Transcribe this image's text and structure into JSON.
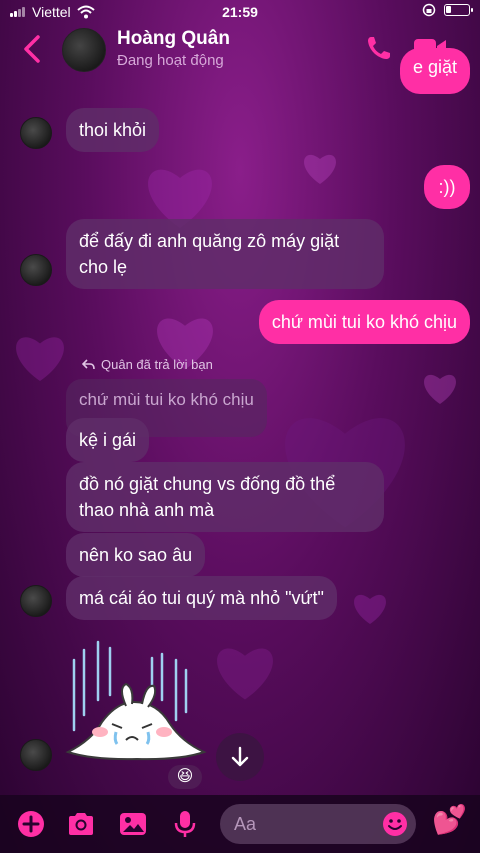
{
  "status_bar": {
    "carrier": "Viettel",
    "time": "21:59",
    "battery_level": 0.25
  },
  "header": {
    "name": "Hoàng Quân",
    "status": "Đang hoạt động",
    "back_icon": "chevron-left-icon",
    "call_icon": "phone-icon",
    "video_icon": "video-camera-icon"
  },
  "messages": {
    "m0": "e giặt",
    "m1": "thoi khỏi",
    "m2": ":))",
    "m3": "để đấy đi anh quăng zô máy giặt cho lẹ",
    "m4": "chứ mùi tui ko khó chịu",
    "reply_note": "Quân đã trả lời bạn",
    "quoted": "chứ mùi tui ko khó chịu",
    "m5": "kệ i gái",
    "m6": "đồ nó giặt chung vs đống đồ thể thao nhà anh mà",
    "m7": "nên ko sao âu",
    "m8": "má cái áo tui quý mà nhỏ \"vứt\"",
    "reaction": "😆"
  },
  "composer": {
    "placeholder": "Aa",
    "plus_icon": "plus-icon",
    "camera_icon": "camera-icon",
    "gallery_icon": "gallery-icon",
    "mic_icon": "microphone-icon",
    "emoji_icon": "emoji-icon",
    "like_icon": "hearts-icon",
    "like_glyph": "💕"
  },
  "colors": {
    "accent": "#ff2fa5",
    "background": "#5a0d5e",
    "bubble_other": "#5f2d69"
  }
}
